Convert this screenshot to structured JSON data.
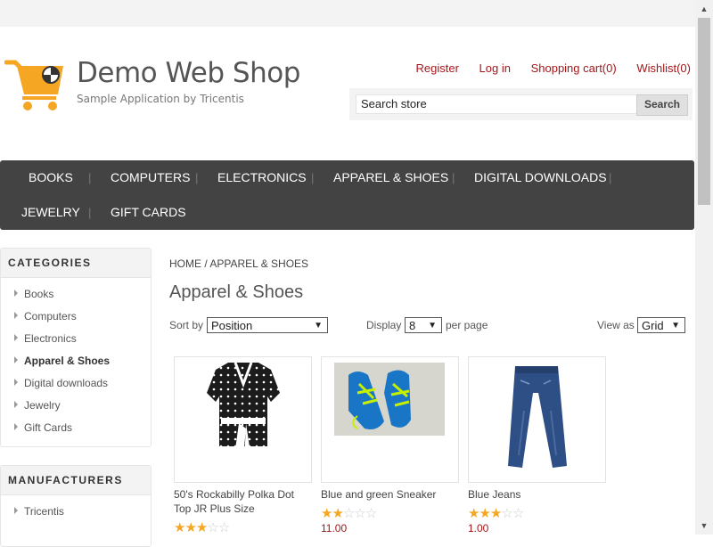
{
  "header": {
    "title": "Demo Web Shop",
    "subtitle": "Sample Application by Tricentis",
    "links": {
      "register": "Register",
      "login": "Log in",
      "cart": "Shopping cart(0)",
      "wishlist": "Wishlist(0)"
    },
    "search": {
      "value": "Search store",
      "button": "Search"
    }
  },
  "menu": {
    "books": "BOOKS",
    "computers": "COMPUTERS",
    "electronics": "ELECTRONICS",
    "apparel": "APPAREL & SHOES",
    "digital": "DIGITAL DOWNLOADS",
    "jewelry": "JEWELRY",
    "giftcards": "GIFT CARDS",
    "separator": "|"
  },
  "sidebar": {
    "categories_title": "CATEGORIES",
    "categories": [
      "Books",
      "Computers",
      "Electronics",
      "Apparel & Shoes",
      "Digital downloads",
      "Jewelry",
      "Gift Cards"
    ],
    "manufacturers_title": "MANUFACTURERS",
    "manufacturers": [
      "Tricentis"
    ]
  },
  "main": {
    "breadcrumb": "HOME / APPAREL & SHOES",
    "title": "Apparel & Shoes",
    "sort_label": "Sort by",
    "sort_value": "Position",
    "display_label": "Display",
    "display_value": "8",
    "per_page_label": "per page",
    "view_label": "View as",
    "view_value": "Grid"
  },
  "products": [
    {
      "title": "50's Rockabilly Polka Dot Top JR Plus Size",
      "rating": 2.5,
      "price": ""
    },
    {
      "title": "Blue and green Sneaker",
      "rating": 2,
      "price": "11.00"
    },
    {
      "title": "Blue Jeans",
      "rating": 3,
      "price": "1.00"
    }
  ],
  "colors": {
    "accent": "#a4161a",
    "menu_bg": "#434343",
    "star": "#f5a623",
    "cart_logo": "#f5a623"
  }
}
